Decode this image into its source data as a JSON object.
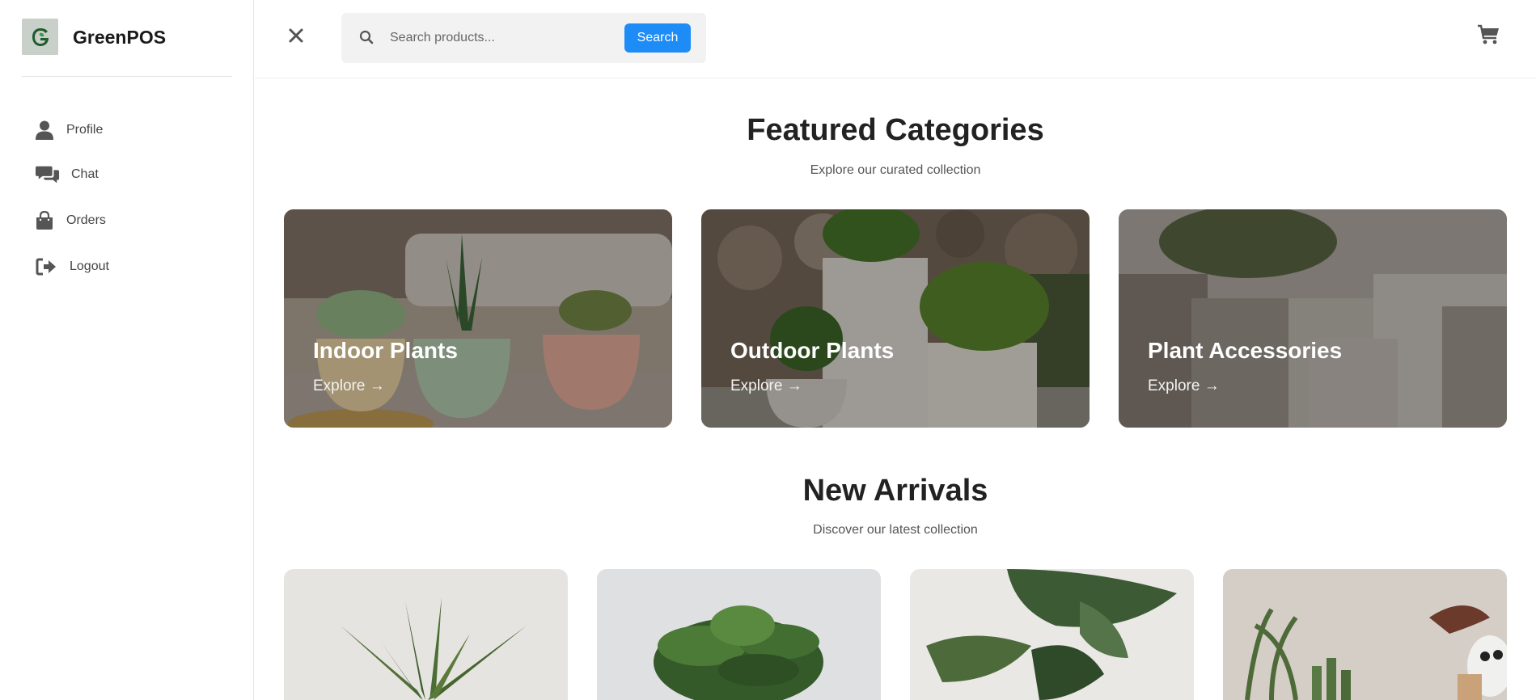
{
  "brand": {
    "name": "GreenPOS",
    "logo_icon": "leaf-g-logo"
  },
  "sidebar": {
    "items": [
      {
        "label": "Profile",
        "icon": "user-icon"
      },
      {
        "label": "Chat",
        "icon": "chat-icon"
      },
      {
        "label": "Orders",
        "icon": "bag-icon"
      },
      {
        "label": "Logout",
        "icon": "logout-icon"
      }
    ]
  },
  "header": {
    "search": {
      "placeholder": "Search products...",
      "value": "",
      "button_label": "Search"
    },
    "close_icon": "close-icon",
    "cart_icon": "cart-icon"
  },
  "featured": {
    "title": "Featured Categories",
    "subtitle": "Explore our curated collection",
    "categories": [
      {
        "title": "Indoor Plants",
        "link": "Explore →"
      },
      {
        "title": "Outdoor Plants",
        "link": "Explore →"
      },
      {
        "title": "Plant Accessories",
        "link": "Explore →"
      }
    ]
  },
  "arrivals": {
    "title": "New Arrivals",
    "subtitle": "Discover our latest collection",
    "products": [
      {
        "image": "snake-plant"
      },
      {
        "image": "rubber-plant"
      },
      {
        "image": "fiddle-leaf"
      },
      {
        "image": "succulent-arrangement"
      }
    ]
  },
  "colors": {
    "accent": "#1e8cf6",
    "text": "#222222",
    "icon": "#555555"
  }
}
